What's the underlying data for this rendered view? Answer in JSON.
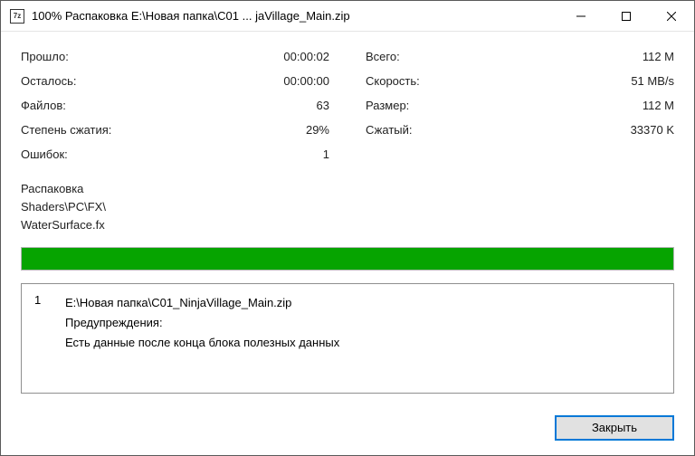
{
  "titlebar": {
    "icon_text": "7z",
    "title": "100% Распаковка E:\\Новая папка\\C01 ... jaVillage_Main.zip"
  },
  "stats": {
    "left": [
      {
        "label": "Прошло:",
        "value": "00:00:02"
      },
      {
        "label": "Осталось:",
        "value": "00:00:00"
      },
      {
        "label": "Файлов:",
        "value": "63"
      },
      {
        "label": "Степень сжатия:",
        "value": "29%"
      },
      {
        "label": "Ошибок:",
        "value": "1"
      }
    ],
    "right": [
      {
        "label": "Всего:",
        "value": "112 M"
      },
      {
        "label": "Скорость:",
        "value": "51 MB/s"
      },
      {
        "label": "Размер:",
        "value": "112 M"
      },
      {
        "label": "Сжатый:",
        "value": "33370 K"
      }
    ]
  },
  "operation": {
    "title": "Распаковка",
    "path_line1": "Shaders\\PC\\FX\\",
    "path_line2": "WaterSurface.fx"
  },
  "messages": {
    "index": "1",
    "line1": "E:\\Новая папка\\C01_NinjaVillage_Main.zip",
    "line2": "Предупреждения:",
    "line3": "Есть данные после конца блока полезных данных"
  },
  "footer": {
    "close_label": "Закрыть"
  }
}
